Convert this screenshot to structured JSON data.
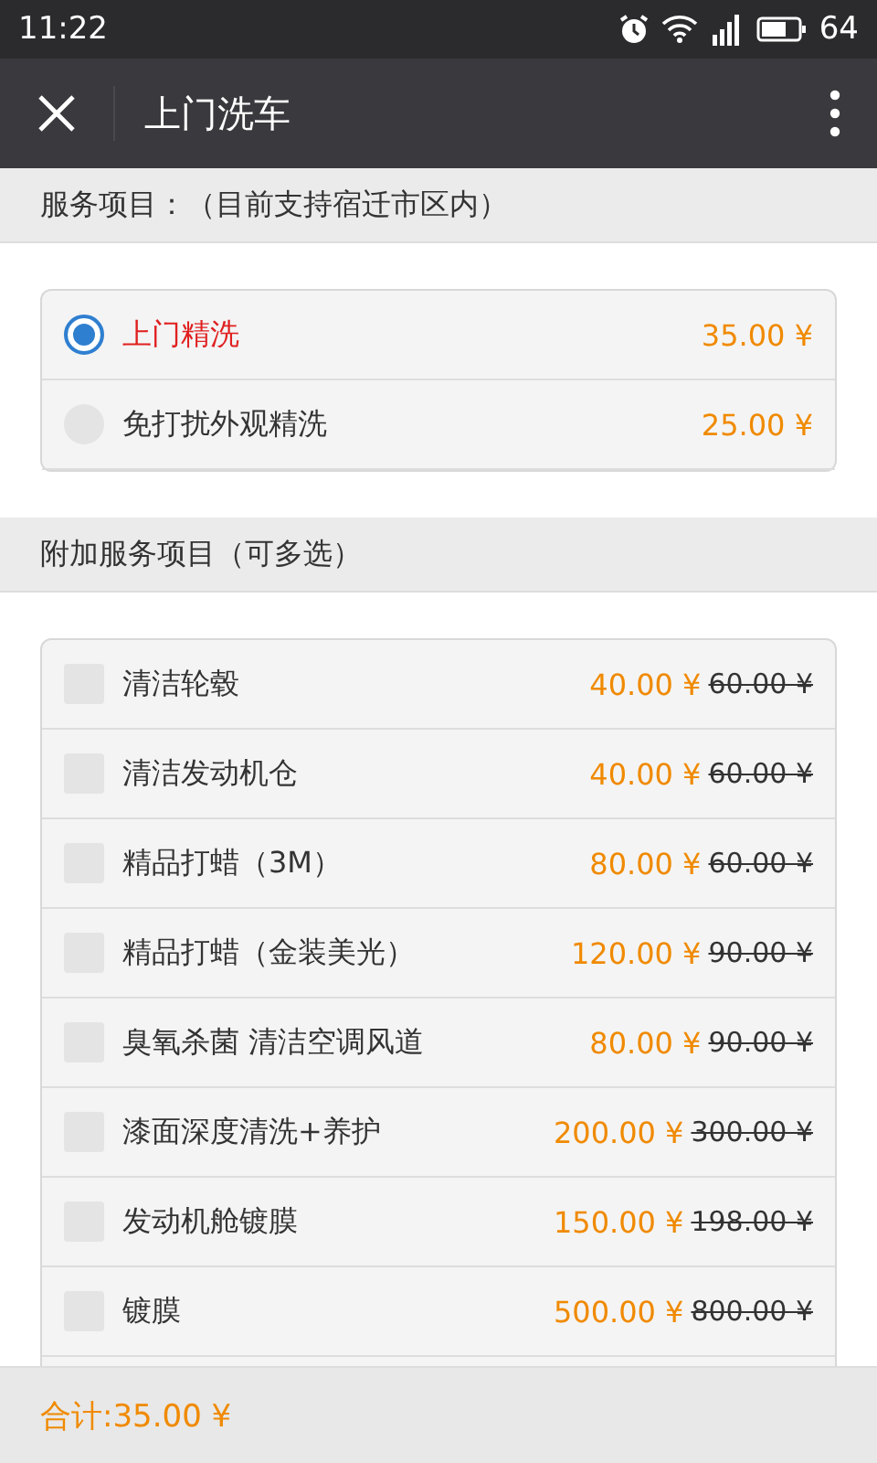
{
  "status_bar": {
    "time": "11:22",
    "battery": "64"
  },
  "title_bar": {
    "title": "上门洗车"
  },
  "service_section": {
    "heading": "服务项目：（目前支持宿迁市区内）",
    "options": [
      {
        "name": "上门精洗",
        "price": "35.00 ¥",
        "selected": true
      },
      {
        "name": "免打扰外观精洗",
        "price": "25.00 ¥",
        "selected": false
      }
    ]
  },
  "addon_section": {
    "heading": "附加服务项目（可多选）",
    "items": [
      {
        "name": "清洁轮毂",
        "price": "40.00 ¥",
        "original_price": "60.00 ¥",
        "checked": false
      },
      {
        "name": "清洁发动机仓",
        "price": "40.00 ¥",
        "original_price": "60.00 ¥",
        "checked": false
      },
      {
        "name": "精品打蜡（3M）",
        "price": "80.00 ¥",
        "original_price": "60.00 ¥",
        "checked": false
      },
      {
        "name": "精品打蜡（金装美光）",
        "price": "120.00 ¥",
        "original_price": "90.00 ¥",
        "checked": false
      },
      {
        "name": "臭氧杀菌 清洁空调风道",
        "price": "80.00 ¥",
        "original_price": "90.00 ¥",
        "checked": false
      },
      {
        "name": "漆面深度清洗+养护",
        "price": "200.00 ¥",
        "original_price": "300.00 ¥",
        "checked": false
      },
      {
        "name": "发动机舱镀膜",
        "price": "150.00 ¥",
        "original_price": "198.00 ¥",
        "checked": false
      },
      {
        "name": "镀膜",
        "price": "500.00 ¥",
        "original_price": "800.00 ¥",
        "checked": false
      }
    ]
  },
  "footer": {
    "total": "合计:35.00 ¥"
  }
}
